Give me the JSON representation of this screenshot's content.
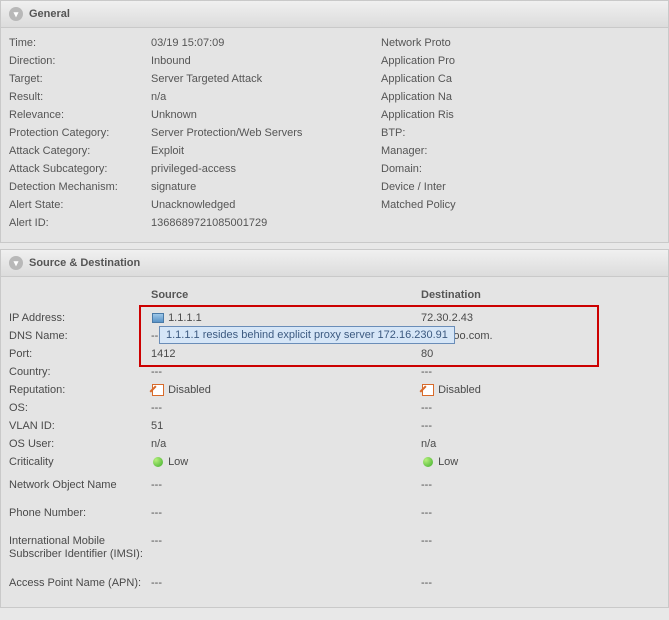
{
  "general": {
    "title": "General",
    "rows": [
      {
        "label": "Time:",
        "value": "03/19 15:07:09",
        "right": "Network Proto"
      },
      {
        "label": "Direction:",
        "value": "Inbound",
        "right": "Application Pro"
      },
      {
        "label": "Target:",
        "value": "Server Targeted Attack",
        "right": "Application Ca"
      },
      {
        "label": "Result:",
        "value": "n/a",
        "right": "Application Na"
      },
      {
        "label": "Relevance:",
        "value": "Unknown",
        "right": "Application Ris"
      },
      {
        "label": "Protection Category:",
        "value": "Server Protection/Web Servers",
        "right": "BTP:"
      },
      {
        "label": "Attack Category:",
        "value": "Exploit",
        "right": "Manager:"
      },
      {
        "label": "Attack Subcategory:",
        "value": "privileged-access",
        "right": "Domain:"
      },
      {
        "label": "Detection Mechanism:",
        "value": "signature",
        "right": "Device / Inter"
      },
      {
        "label": "Alert State:",
        "value": "Unacknowledged",
        "right": "Matched Policy"
      },
      {
        "label": "Alert ID:",
        "value": "1368689721085001729",
        "right": ""
      }
    ]
  },
  "sd": {
    "title": "Source & Destination",
    "head_source": "Source",
    "head_dest": "Destination",
    "tooltip": "1.1.1.1 resides behind explicit proxy server 172.16.230.91",
    "rows": [
      {
        "label": "IP Address:",
        "srcIcon": "host",
        "src": "1.1.1.1",
        "dst": "72.30.2.43"
      },
      {
        "label": "DNS Name:",
        "src": "--",
        "dst": "k1.yahoo.com."
      },
      {
        "label": "Port:",
        "src": "1412",
        "dst": "80"
      },
      {
        "label": "Country:",
        "src": "---",
        "dst": "---"
      },
      {
        "label": "Reputation:",
        "srcIcon": "disabled",
        "src": "Disabled",
        "dstIcon": "disabled",
        "dst": "Disabled"
      },
      {
        "label": "OS:",
        "src": "---",
        "dst": "---"
      },
      {
        "label": "VLAN ID:",
        "src": "51",
        "dst": "---"
      },
      {
        "label": "OS User:",
        "src": "n/a",
        "dst": "n/a"
      },
      {
        "label": "Criticality",
        "srcIcon": "green",
        "src": "Low",
        "dstIcon": "green",
        "dst": "Low"
      },
      {
        "label": "Network Object Name",
        "src": "---",
        "dst": "---"
      },
      {
        "label": "Phone Number:",
        "src": "---",
        "dst": "---"
      },
      {
        "label": "International Mobile Subscriber Identifier (IMSI):",
        "src": "---",
        "dst": "---"
      },
      {
        "label": "Access Point Name (APN):",
        "src": "---",
        "dst": "---"
      }
    ]
  }
}
